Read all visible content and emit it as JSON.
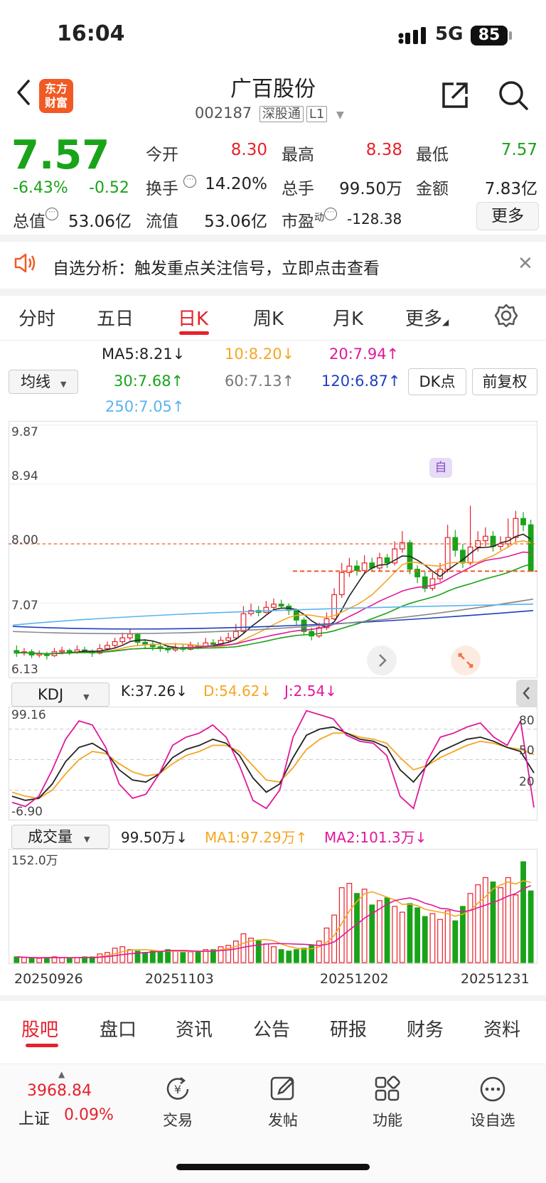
{
  "status": {
    "time": "16:04",
    "network": "5G",
    "battery": "85"
  },
  "header": {
    "logo_text": "东方财富",
    "title": "广百股份",
    "code": "002187",
    "tag1": "深股通",
    "tag2": "L1"
  },
  "quote": {
    "price": "7.57",
    "pct": "-6.43%",
    "change": "-0.52",
    "fields": [
      {
        "label": "今开",
        "value": "8.30",
        "color": "#e8202a"
      },
      {
        "label": "最高",
        "value": "8.38",
        "color": "#e8202a"
      },
      {
        "label": "最低",
        "value": "7.57",
        "color": "#19a319"
      },
      {
        "label": "换手",
        "value": "14.20%",
        "color": "#222"
      },
      {
        "label": "总手",
        "value": "99.50万",
        "color": "#222"
      },
      {
        "label": "金额",
        "value": "7.83亿",
        "color": "#222"
      },
      {
        "label": "总值",
        "value": "53.06亿",
        "color": "#222"
      },
      {
        "label": "流值",
        "value": "53.06亿",
        "color": "#222"
      },
      {
        "label": "市盈",
        "value": "-128.38",
        "color": "#222"
      }
    ],
    "pe_sup": "动",
    "more": "更多"
  },
  "banner": {
    "text": "自选分析：触发重点关注信号，立即点击查看"
  },
  "tabs": [
    "分时",
    "五日",
    "日K",
    "周K",
    "月K",
    "更多"
  ],
  "active_tab": "日K",
  "ma": {
    "select": "均线",
    "items": [
      {
        "text": "MA5:8.21↓",
        "color": "#222"
      },
      {
        "text": "10:8.20↓",
        "color": "#f5a623"
      },
      {
        "text": "20:7.94↑",
        "color": "#e0189a"
      },
      {
        "text": "30:7.68↑",
        "color": "#19a319"
      },
      {
        "text": "60:7.13↑",
        "color": "#777777"
      },
      {
        "text": "120:6.87↑",
        "color": "#1f3fbf"
      },
      {
        "text": "250:7.05↑",
        "color": "#5ab4ee"
      }
    ],
    "dk": "DK点",
    "fq": "前复权"
  },
  "kline_axis": [
    "9.87",
    "8.94",
    "8.00",
    "7.07",
    "6.13"
  ],
  "kline_marker": "自",
  "kdj": {
    "select": "KDJ",
    "k": "K:37.26↓",
    "d": "D:54.62↓",
    "j": "J:2.54↓",
    "ytop": "99.16",
    "ybottom": "-6.90",
    "levels": [
      "80",
      "50",
      "20"
    ]
  },
  "volume": {
    "select": "成交量",
    "v": "99.50万↓",
    "ma1": "MA1:97.29万↑",
    "ma2": "MA2:101.3万↓",
    "ytop": "152.0万"
  },
  "dates": [
    "20250926",
    "20251103",
    "20251202",
    "20251231"
  ],
  "bottom_tabs": [
    "股吧",
    "盘口",
    "资讯",
    "公告",
    "研报",
    "财务",
    "资料"
  ],
  "footer": {
    "index_value": "3968.84",
    "index_name": "上证",
    "index_pct": "0.09%",
    "items": [
      "交易",
      "发帖",
      "功能",
      "设自选"
    ]
  },
  "colors": {
    "up": "#e8202a",
    "down": "#19a319",
    "accent": "#e8202a"
  },
  "chart_data": {
    "type": "candlestick",
    "ylim": [
      6.13,
      9.87
    ],
    "candles": [
      [
        6.32,
        6.28,
        6.4,
        6.22
      ],
      [
        6.28,
        6.3,
        6.36,
        6.24
      ],
      [
        6.3,
        6.25,
        6.34,
        6.2
      ],
      [
        6.25,
        6.27,
        6.32,
        6.21
      ],
      [
        6.27,
        6.24,
        6.3,
        6.18
      ],
      [
        6.24,
        6.3,
        6.36,
        6.22
      ],
      [
        6.3,
        6.32,
        6.38,
        6.26
      ],
      [
        6.32,
        6.29,
        6.35,
        6.25
      ],
      [
        6.29,
        6.33,
        6.4,
        6.27
      ],
      [
        6.33,
        6.31,
        6.38,
        6.28
      ],
      [
        6.31,
        6.28,
        6.34,
        6.22
      ],
      [
        6.28,
        6.35,
        6.42,
        6.26
      ],
      [
        6.35,
        6.4,
        6.46,
        6.32
      ],
      [
        6.4,
        6.46,
        6.52,
        6.36
      ],
      [
        6.46,
        6.52,
        6.6,
        6.42
      ],
      [
        6.52,
        6.58,
        6.66,
        6.48
      ],
      [
        6.58,
        6.45,
        6.6,
        6.4
      ],
      [
        6.45,
        6.42,
        6.5,
        6.36
      ],
      [
        6.42,
        6.38,
        6.46,
        6.32
      ],
      [
        6.38,
        6.35,
        6.42,
        6.3
      ],
      [
        6.35,
        6.33,
        6.4,
        6.28
      ],
      [
        6.33,
        6.37,
        6.44,
        6.3
      ],
      [
        6.37,
        6.34,
        6.42,
        6.3
      ],
      [
        6.34,
        6.4,
        6.46,
        6.32
      ],
      [
        6.4,
        6.38,
        6.45,
        6.34
      ],
      [
        6.38,
        6.44,
        6.52,
        6.36
      ],
      [
        6.44,
        6.42,
        6.5,
        6.38
      ],
      [
        6.42,
        6.48,
        6.54,
        6.4
      ],
      [
        6.48,
        6.52,
        6.6,
        6.44
      ],
      [
        6.52,
        6.62,
        6.74,
        6.5
      ],
      [
        6.62,
        6.9,
        7.02,
        6.6
      ],
      [
        6.9,
        6.95,
        7.06,
        6.86
      ],
      [
        6.95,
        6.92,
        7.02,
        6.86
      ],
      [
        6.92,
        7.0,
        7.1,
        6.9
      ],
      [
        7.0,
        7.05,
        7.14,
        6.96
      ],
      [
        7.05,
        7.02,
        7.12,
        6.98
      ],
      [
        7.02,
        6.95,
        7.06,
        6.88
      ],
      [
        6.95,
        6.8,
        6.98,
        6.72
      ],
      [
        6.8,
        6.62,
        6.84,
        6.56
      ],
      [
        6.62,
        6.55,
        6.68,
        6.48
      ],
      [
        6.55,
        6.68,
        6.76,
        6.52
      ],
      [
        6.68,
        6.82,
        6.92,
        6.64
      ],
      [
        6.82,
        7.2,
        7.3,
        6.8
      ],
      [
        7.2,
        7.55,
        7.7,
        7.15
      ],
      [
        7.55,
        7.65,
        7.78,
        7.48
      ],
      [
        7.65,
        7.58,
        7.74,
        7.5
      ],
      [
        7.58,
        7.7,
        7.82,
        7.52
      ],
      [
        7.7,
        7.62,
        7.78,
        7.56
      ],
      [
        7.62,
        7.78,
        7.86,
        7.58
      ],
      [
        7.78,
        7.7,
        7.84,
        7.62
      ],
      [
        7.7,
        7.92,
        8.04,
        7.66
      ],
      [
        7.92,
        8.02,
        8.2,
        7.86
      ],
      [
        8.02,
        7.6,
        8.06,
        7.52
      ],
      [
        7.6,
        7.48,
        7.66,
        7.38
      ],
      [
        7.48,
        7.3,
        7.56,
        7.24
      ],
      [
        7.3,
        7.45,
        7.55,
        7.26
      ],
      [
        7.45,
        7.6,
        7.7,
        7.4
      ],
      [
        7.6,
        8.1,
        8.3,
        7.55
      ],
      [
        8.1,
        7.9,
        8.22,
        7.8
      ],
      [
        7.9,
        7.7,
        8.0,
        7.62
      ],
      [
        7.7,
        7.95,
        8.6,
        7.66
      ],
      [
        7.95,
        8.05,
        8.2,
        7.88
      ],
      [
        8.05,
        8.12,
        8.26,
        7.96
      ],
      [
        8.12,
        7.96,
        8.2,
        7.88
      ],
      [
        7.96,
        8.0,
        8.12,
        7.9
      ],
      [
        8.0,
        8.1,
        8.4,
        7.95
      ],
      [
        8.1,
        8.4,
        8.52,
        8.02
      ],
      [
        8.4,
        8.3,
        8.5,
        8.2
      ],
      [
        8.3,
        7.57,
        8.38,
        7.57
      ]
    ],
    "kdj": {
      "k": [
        14,
        10,
        12,
        26,
        48,
        62,
        66,
        58,
        40,
        30,
        28,
        36,
        52,
        60,
        64,
        70,
        66,
        54,
        32,
        18,
        26,
        52,
        74,
        80,
        82,
        76,
        70,
        68,
        62,
        40,
        28,
        44,
        58,
        64,
        70,
        72,
        68,
        62,
        58,
        37
      ],
      "d": [
        18,
        14,
        12,
        20,
        36,
        50,
        58,
        56,
        46,
        38,
        34,
        36,
        46,
        54,
        58,
        64,
        64,
        58,
        44,
        30,
        28,
        42,
        60,
        70,
        76,
        76,
        72,
        70,
        66,
        52,
        40,
        44,
        52,
        58,
        64,
        68,
        66,
        62,
        60,
        55
      ],
      "j": [
        8,
        4,
        14,
        40,
        70,
        88,
        84,
        62,
        26,
        12,
        16,
        36,
        64,
        72,
        76,
        84,
        72,
        44,
        10,
        2,
        20,
        72,
        98,
        94,
        90,
        74,
        68,
        66,
        54,
        14,
        2,
        48,
        72,
        76,
        82,
        86,
        72,
        64,
        88,
        3
      ]
    },
    "volume": [
      8,
      7,
      6,
      6,
      7,
      8,
      7,
      6,
      7,
      8,
      8,
      12,
      14,
      20,
      22,
      18,
      16,
      14,
      16,
      15,
      18,
      16,
      14,
      15,
      16,
      18,
      18,
      22,
      24,
      30,
      40,
      34,
      30,
      26,
      22,
      18,
      16,
      18,
      20,
      24,
      30,
      48,
      66,
      104,
      110,
      96,
      102,
      80,
      86,
      90,
      78,
      70,
      82,
      76,
      64,
      68,
      60,
      72,
      58,
      78,
      96,
      108,
      118,
      112,
      104,
      118,
      94,
      140,
      99.5
    ],
    "vol_ylim": [
      0,
      152
    ]
  }
}
